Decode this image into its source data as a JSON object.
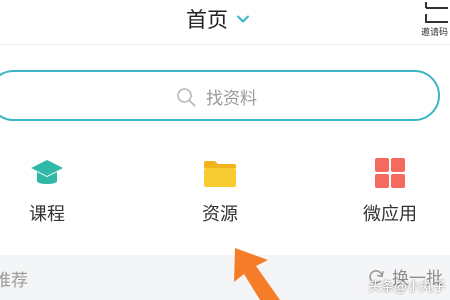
{
  "header": {
    "title": "首页",
    "title_chevron_icon": "chevron-down-icon",
    "invite_label": "邀请码",
    "invite_icon": "scan-frame-icon"
  },
  "search": {
    "icon": "search-icon",
    "placeholder": "找资料"
  },
  "features": [
    {
      "label": "课程",
      "icon": "graduation-cap-icon",
      "color": "#2fb9a6"
    },
    {
      "label": "资源",
      "icon": "folder-icon",
      "color": "#f7cc33"
    },
    {
      "label": "微应用",
      "icon": "grid-apps-icon",
      "color": "#f46a5e"
    }
  ],
  "recommend": {
    "left_label": "推荐",
    "refresh_label": "换一批",
    "refresh_icon": "refresh-icon"
  },
  "accent_color": "#3cb5c6",
  "annotation_arrow_color": "#f57c28",
  "watermark": "头条@小丸子"
}
